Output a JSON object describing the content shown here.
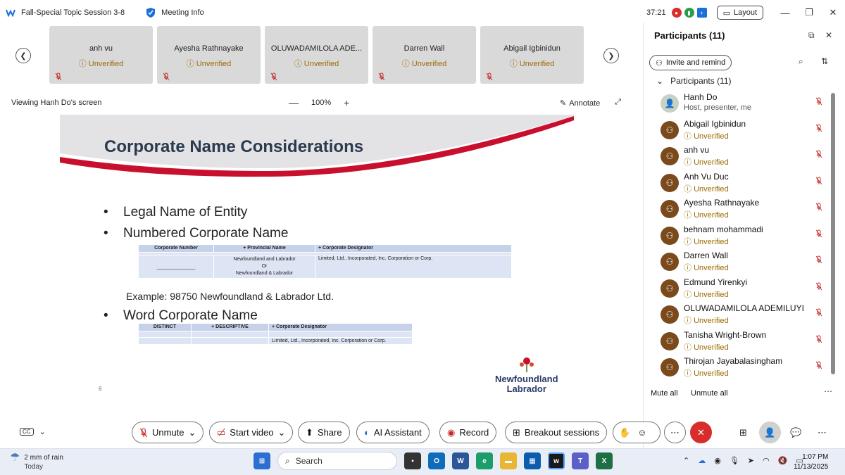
{
  "window": {
    "meeting_title": "Fall-Special Topic Session 3-8",
    "meeting_info": "Meeting Info",
    "timer": "37:21",
    "layout_label": "Layout"
  },
  "thumbnails": [
    {
      "name": "anh vu",
      "status": "Unverified"
    },
    {
      "name": "Ayesha Rathnayake",
      "status": "Unverified"
    },
    {
      "name": "OLUWADAMILOLA ADE...",
      "status": "Unverified"
    },
    {
      "name": "Darren Wall",
      "status": "Unverified"
    },
    {
      "name": "Abigail Igbinidun",
      "status": "Unverified"
    }
  ],
  "share": {
    "viewing": "Viewing Hanh Do's screen",
    "zoom": "100%",
    "annotate": "Annotate"
  },
  "slide": {
    "title": "Corporate Name Considerations",
    "bullet1": "Legal Name of Entity",
    "bullet2": "Numbered Corporate Name",
    "table1_headers": [
      "Corporate Number",
      "+ Provincial Name",
      "+ Corporate Designator"
    ],
    "table1_blank": "______________",
    "table1_province_1": "Newfoundland and Labrador",
    "table1_province_or": "Or",
    "table1_province_2": "Newfoundland & Labrador",
    "table1_designators": "Limited, Ltd., Incorporated, Inc. Corporation or Corp.",
    "example": "Example: 98750 Newfoundland & Labrador Ltd.",
    "bullet3": "Word Corporate Name",
    "table2_headers": [
      "DISTINCT",
      "+ DESCRIPTIVE",
      "+ Corporate Designator"
    ],
    "table2_designators": "Limited, Ltd., Incorporated, Inc. Corporation or Corp.",
    "page_number": "6",
    "logo_line1": "Newfoundland",
    "logo_line2": "Labrador"
  },
  "panel": {
    "title": "Participants (11)",
    "invite_label": "Invite and remind",
    "group_label": "Participants (11)",
    "participants": [
      {
        "name": "Hanh Do",
        "sub": "Host, presenter, me"
      },
      {
        "name": "Abigail Igbinidun",
        "sub": "Unverified"
      },
      {
        "name": "anh vu",
        "sub": "Unverified"
      },
      {
        "name": "Anh Vu Duc",
        "sub": "Unverified"
      },
      {
        "name": "Ayesha Rathnayake",
        "sub": "Unverified"
      },
      {
        "name": "behnam mohammadi",
        "sub": "Unverified"
      },
      {
        "name": "Darren Wall",
        "sub": "Unverified"
      },
      {
        "name": "Edmund Yirenkyi",
        "sub": "Unverified"
      },
      {
        "name": "OLUWADAMILOLA ADEMILUYI",
        "sub": "Unverified"
      },
      {
        "name": "Tanisha Wright-Brown",
        "sub": "Unverified"
      },
      {
        "name": "Thirojan Jayabalasingham",
        "sub": "Unverified"
      }
    ],
    "mute_all": "Mute all",
    "unmute_all": "Unmute all"
  },
  "controls": {
    "unmute": "Unmute",
    "start_video": "Start video",
    "share": "Share",
    "ai_assistant": "AI Assistant",
    "record": "Record",
    "breakout": "Breakout sessions"
  },
  "taskbar": {
    "weather_text": "2 mm of rain",
    "weather_sub": "Today",
    "search": "Search",
    "time": "1:07 PM",
    "date": "11/13/2025"
  },
  "colors": {
    "accent_red": "#d72d2d",
    "slide_swoosh": "#c8102e",
    "unverified": "#9a6a00",
    "thumb_bg": "#d9d9d9",
    "avatar_bg": "#7a4a1c"
  }
}
